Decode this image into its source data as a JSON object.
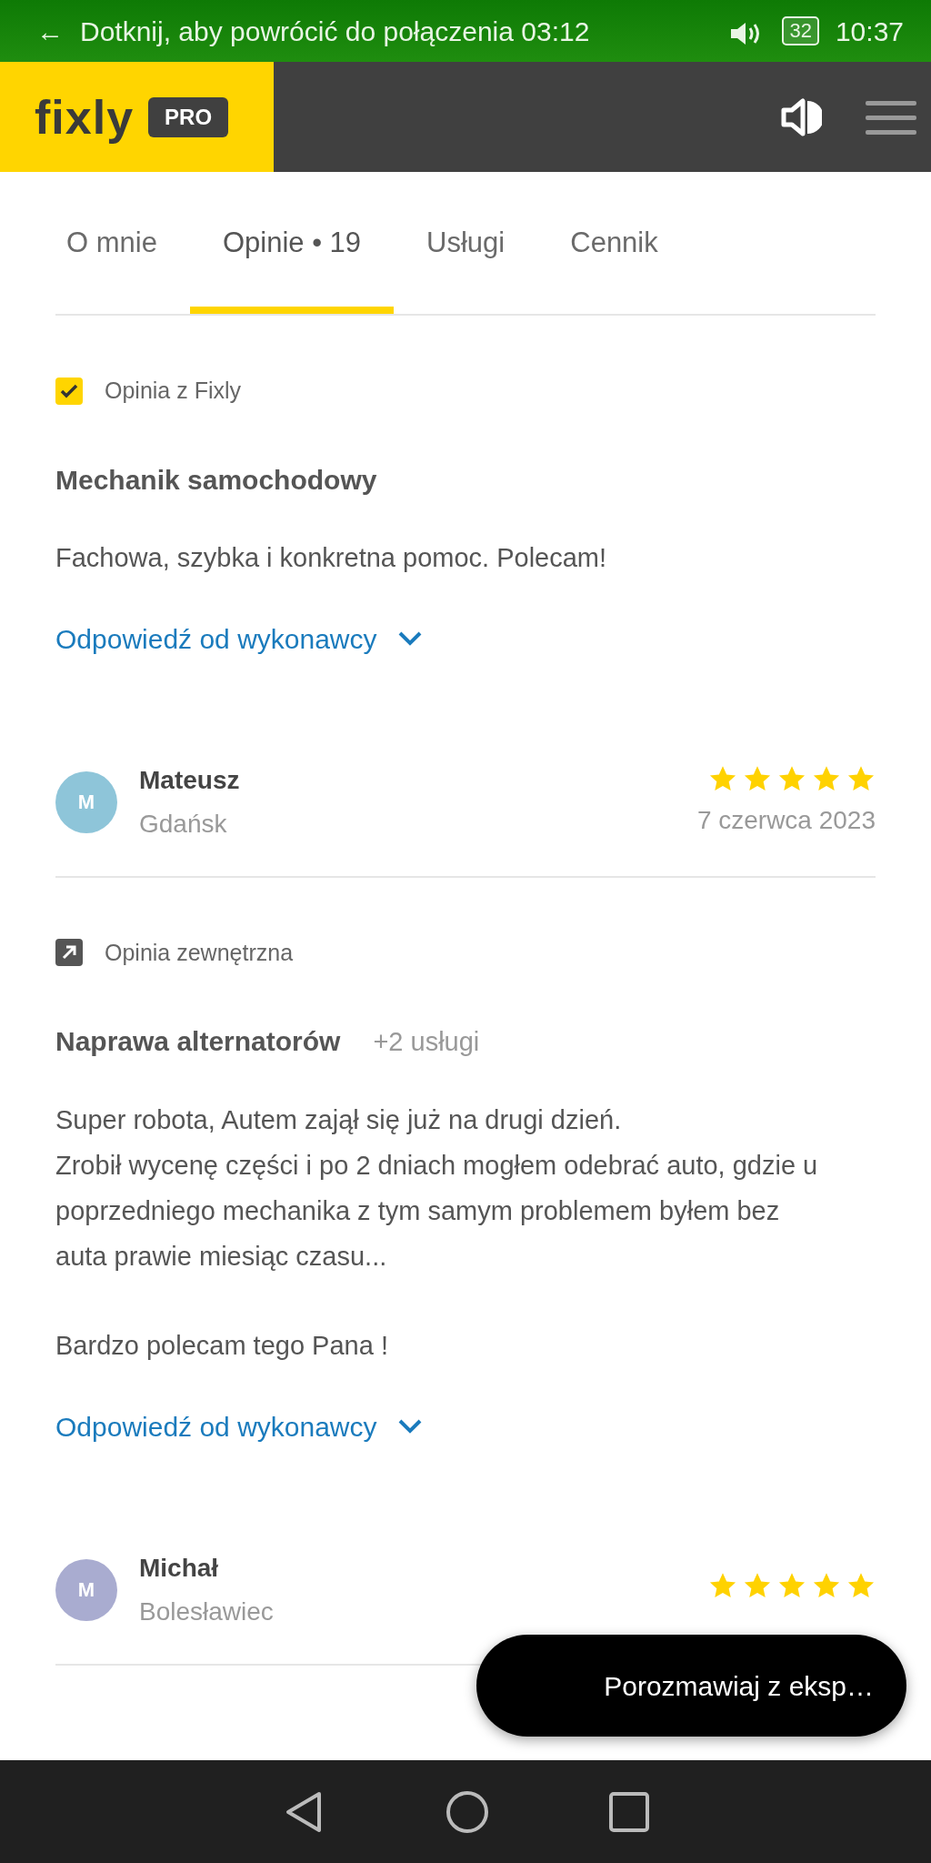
{
  "status_bar": {
    "back": "←",
    "message": "Dotknij, aby powrócić do połączenia 03:12",
    "battery": "32",
    "time": "10:37"
  },
  "header": {
    "logo": "fixly",
    "badge": "PRO"
  },
  "tabs": [
    {
      "label": "O mnie",
      "selected": false
    },
    {
      "label": "Opinie • 19",
      "selected": true
    },
    {
      "label": "Usługi",
      "selected": false
    },
    {
      "label": "Cennik",
      "selected": false
    }
  ],
  "feed": [
    {
      "kind": "review",
      "source": {
        "kind": "fixly",
        "label": "Opinia z Fixly"
      },
      "title": "Mechanik samochodowy",
      "paragraphs": [
        "Fachowa, szybka i konkretna pomoc. Polecam!"
      ],
      "reply_link": "Odpowiedź od wykonawcy"
    },
    {
      "kind": "reviewer",
      "initial": "M",
      "color": "#8ec5d9",
      "name": "Mateusz",
      "city": "Gdańsk",
      "stars": 5,
      "date": "7 czerwca 2023"
    },
    {
      "kind": "review",
      "source": {
        "kind": "external",
        "label": "Opinia zewnętrzna"
      },
      "title": "Naprawa alternatorów",
      "extra": "+2 usługi",
      "paragraphs": [
        "Super robota, Autem zajął się już na drugi dzień.\nZrobił wycenę części i po 2 dniach mogłem odebrać auto, gdzie u poprzedniego mechanika z tym samym problemem byłem bez auta prawie miesiąc czasu...",
        "Bardzo polecam tego Pana !"
      ],
      "reply_link": "Odpowiedź od wykonawcy"
    },
    {
      "kind": "reviewer",
      "initial": "M",
      "color": "#a9acd0",
      "name": "Michał",
      "city": "Bolesławiec",
      "stars": 5
    }
  ],
  "chat_button": "Porozmawiaj z eksp…"
}
